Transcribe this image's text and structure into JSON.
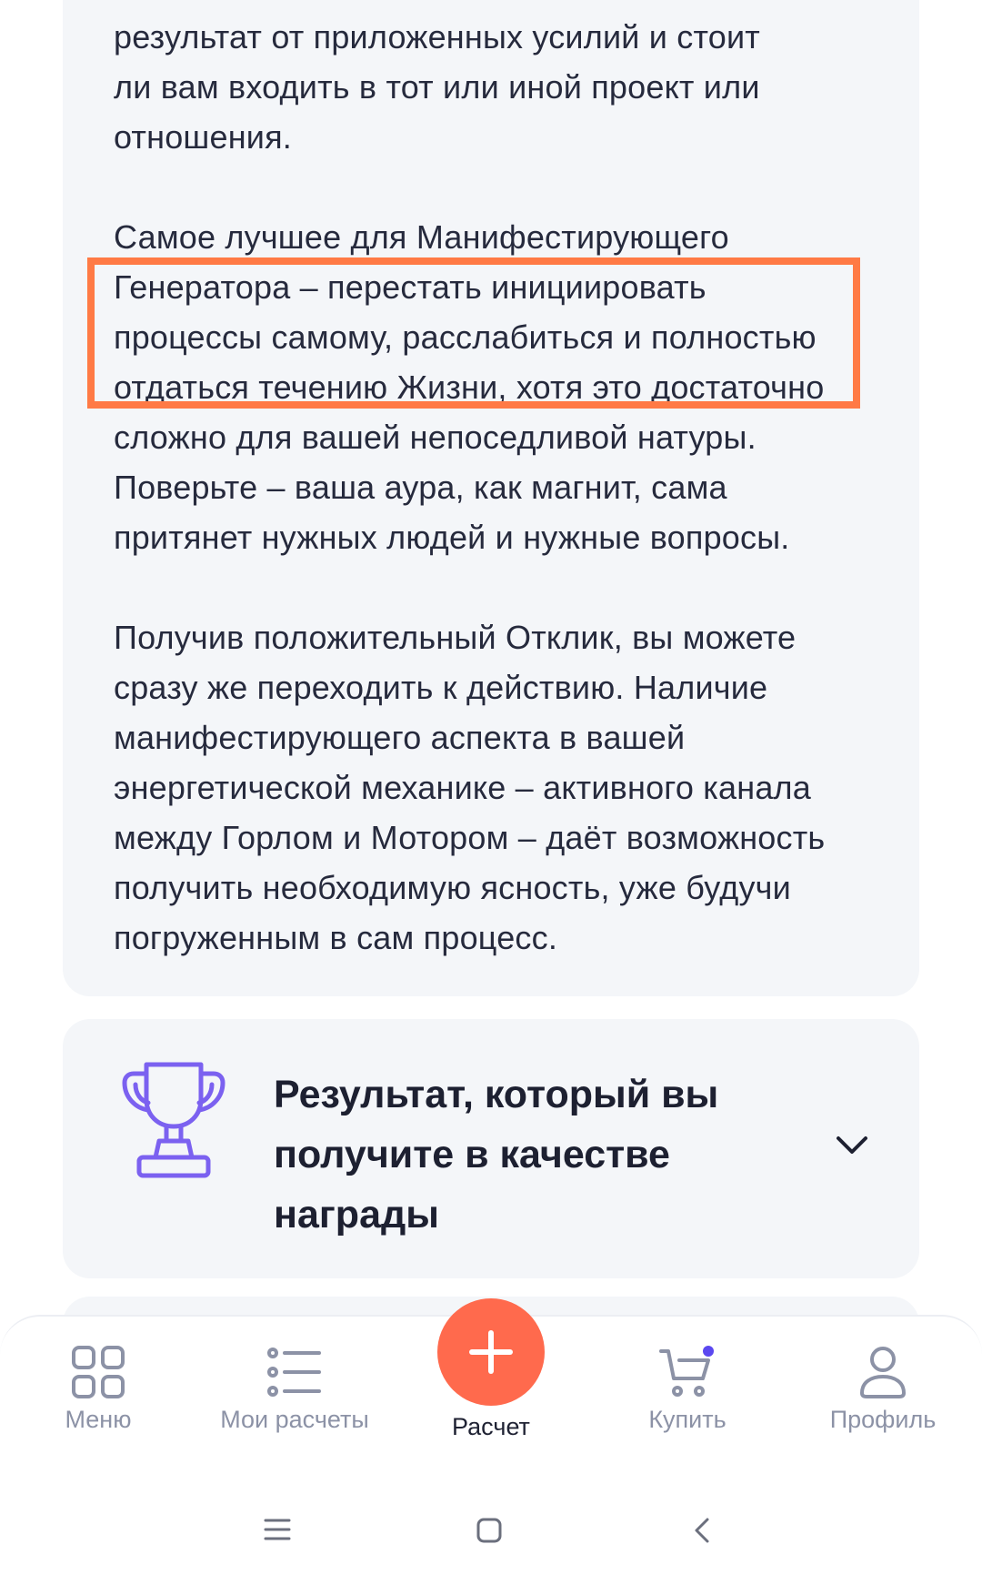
{
  "article": {
    "paragraph1": [
      "результат от приложенных усилий и стоит",
      "ли вам входить в тот или иной проект или",
      "отношения."
    ],
    "paragraph2": [
      "Самое лучшее для Манифестирующего",
      "Генератора – перестать инициировать",
      "процессы самому, расслабиться и полностью",
      "отдаться течению Жизни, хотя это достаточно",
      "сложно для вашей непоседливой натуры.",
      "Поверьте – ваша аура, как магнит, сама",
      "притянет нужных людей и нужные вопросы."
    ],
    "paragraph3": [
      "Получив положительный Отклик, вы можете",
      "сразу же переходить к действию. Наличие",
      "манифестирующего аспекта в вашей",
      "энергетической механике – активного канала",
      "между Горлом и Мотором – даёт возможность",
      "получить необходимую ясность, уже будучи",
      "погруженным в сам процесс."
    ]
  },
  "result_section": {
    "title": "Результат, который вы получите в качестве награды",
    "icon": "trophy-icon"
  },
  "bottom_nav": {
    "menu": "Меню",
    "my_calcs": "Мои расчеты",
    "create": "Расчет",
    "buy": "Купить",
    "profile": "Профиль"
  },
  "colors": {
    "accent": "#ff6a4d",
    "highlight": "#ff7a45",
    "icon_purple": "#7b61f0",
    "card_bg": "#f4f6f9",
    "nav_grey": "#8c92a6"
  }
}
